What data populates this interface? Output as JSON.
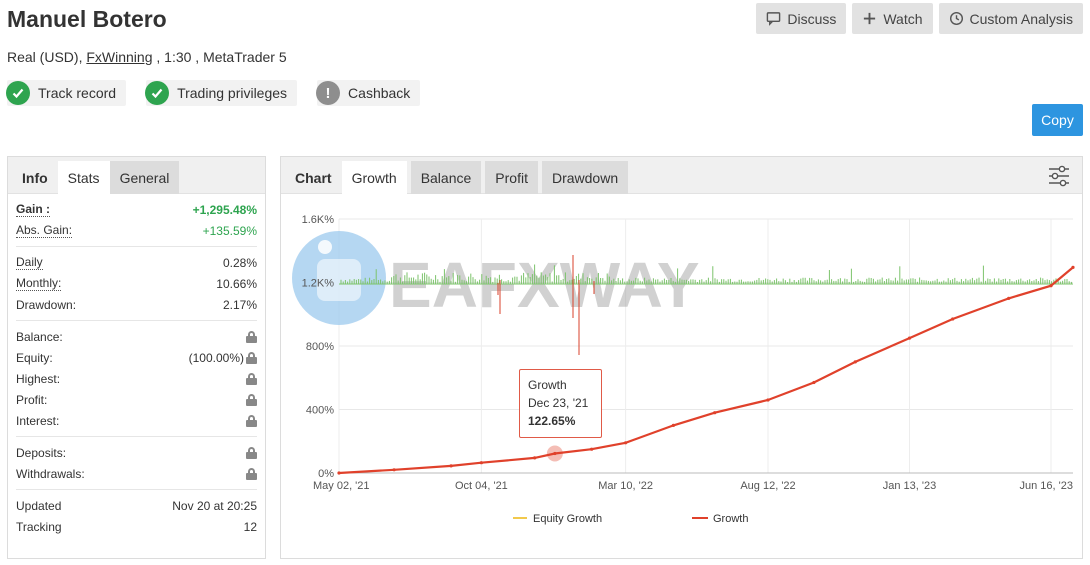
{
  "header": {
    "title": "Manuel Botero",
    "account_type": "Real (USD),",
    "broker": "FxWinning",
    "leverage_platform": ", 1:30 , MetaTrader 5"
  },
  "top_buttons": {
    "discuss": "Discuss",
    "watch": "Watch",
    "custom_analysis": "Custom Analysis"
  },
  "badges": [
    {
      "label": "Track record",
      "icon": "check-icon"
    },
    {
      "label": "Trading privileges",
      "icon": "check-icon"
    },
    {
      "label": "Cashback",
      "icon": "exclamation-icon"
    }
  ],
  "copy_label": "Copy",
  "left_tabs": {
    "label": "Info",
    "stats": "Stats",
    "general": "General"
  },
  "stats": {
    "gain": {
      "label": "Gain :",
      "value": "+1,295.48%"
    },
    "abs_gain": {
      "label": "Abs. Gain:",
      "value": "+135.59%"
    },
    "daily": {
      "label": "Daily",
      "value": "0.28%"
    },
    "monthly": {
      "label": "Monthly:",
      "value": "10.66%"
    },
    "drawdown": {
      "label": "Drawdown:",
      "value": "2.17%"
    },
    "balance": {
      "label": "Balance:"
    },
    "equity": {
      "label": "Equity:",
      "value": "(100.00%)"
    },
    "highest": {
      "label": "Highest:"
    },
    "profit": {
      "label": "Profit:"
    },
    "interest": {
      "label": "Interest:"
    },
    "deposits": {
      "label": "Deposits:"
    },
    "withdrawals": {
      "label": "Withdrawals:"
    },
    "updated": {
      "label": "Updated",
      "value": "Nov 20 at 20:25"
    },
    "tracking": {
      "label": "Tracking",
      "value": "12"
    }
  },
  "chart_tabs": {
    "label": "Chart",
    "growth": "Growth",
    "balance": "Balance",
    "profit": "Profit",
    "drawdown": "Drawdown"
  },
  "watermark": "EAFXWAY",
  "tooltip": {
    "title": "Growth",
    "date": "Dec 23, '21",
    "value": "122.65%"
  },
  "colors": {
    "growth": "#e0412b",
    "equity": "#f2c94c",
    "bars": "#7cc36b",
    "accent": "#2d95e0"
  },
  "chart_data": {
    "type": "line",
    "title": "",
    "xlabel": "",
    "ylabel": "",
    "ylim": [
      0,
      1600
    ],
    "y_ticks": [
      "0%",
      "400%",
      "800%",
      "1.2K%",
      "1.6K%"
    ],
    "x_ticks": [
      "May 02, '21",
      "Oct 04, '21",
      "Mar 10, '22",
      "Aug 12, '22",
      "Jan 13, '23",
      "Jun 16, '23"
    ],
    "legend": [
      "Equity Growth",
      "Growth"
    ],
    "legend_position": "bottom",
    "series": [
      {
        "name": "Growth",
        "x": [
          "2021-05-02",
          "2021-07-01",
          "2021-09-01",
          "2021-10-04",
          "2021-12-01",
          "2021-12-23",
          "2022-02-01",
          "2022-03-10",
          "2022-05-01",
          "2022-06-15",
          "2022-08-12",
          "2022-10-01",
          "2022-11-15",
          "2023-01-13",
          "2023-03-01",
          "2023-05-01",
          "2023-06-16",
          "2023-07-10"
        ],
        "y": [
          0,
          20,
          45,
          65,
          95,
          123,
          150,
          190,
          300,
          380,
          460,
          570,
          700,
          850,
          970,
          1100,
          1180,
          1295
        ]
      }
    ]
  }
}
